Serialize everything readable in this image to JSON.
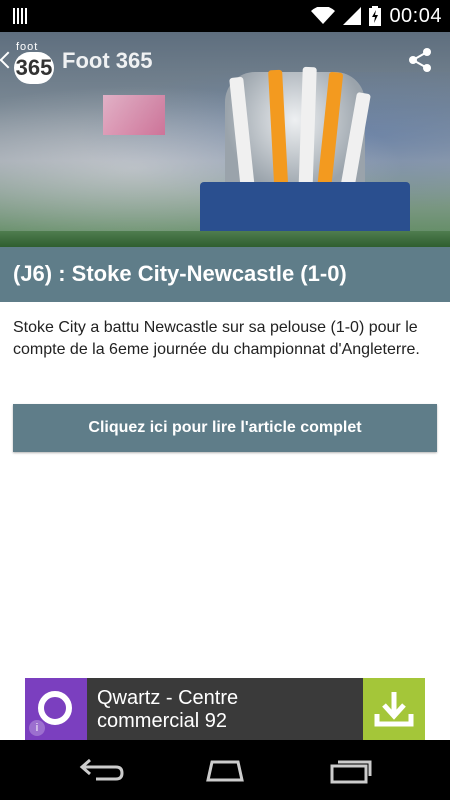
{
  "status_bar": {
    "time": "00:04"
  },
  "app": {
    "logo_top": "foot",
    "logo_num": "365",
    "title": "Foot 365"
  },
  "article": {
    "title": "(J6) : Stoke City-Newcastle (1-0)",
    "summary": "Stoke City a battu Newcastle sur sa pelouse (1-0) pour le compte de la 6eme journée du championnat d'Angleterre.",
    "read_button": "Cliquez ici pour lire l'article complet"
  },
  "ad": {
    "line1": "Qwartz - Centre",
    "line2": "commercial 92",
    "info_glyph": "i",
    "icon_color": "#7b3fbf",
    "download_color": "#a4c639"
  },
  "colors": {
    "accent": "#5f7d89"
  }
}
